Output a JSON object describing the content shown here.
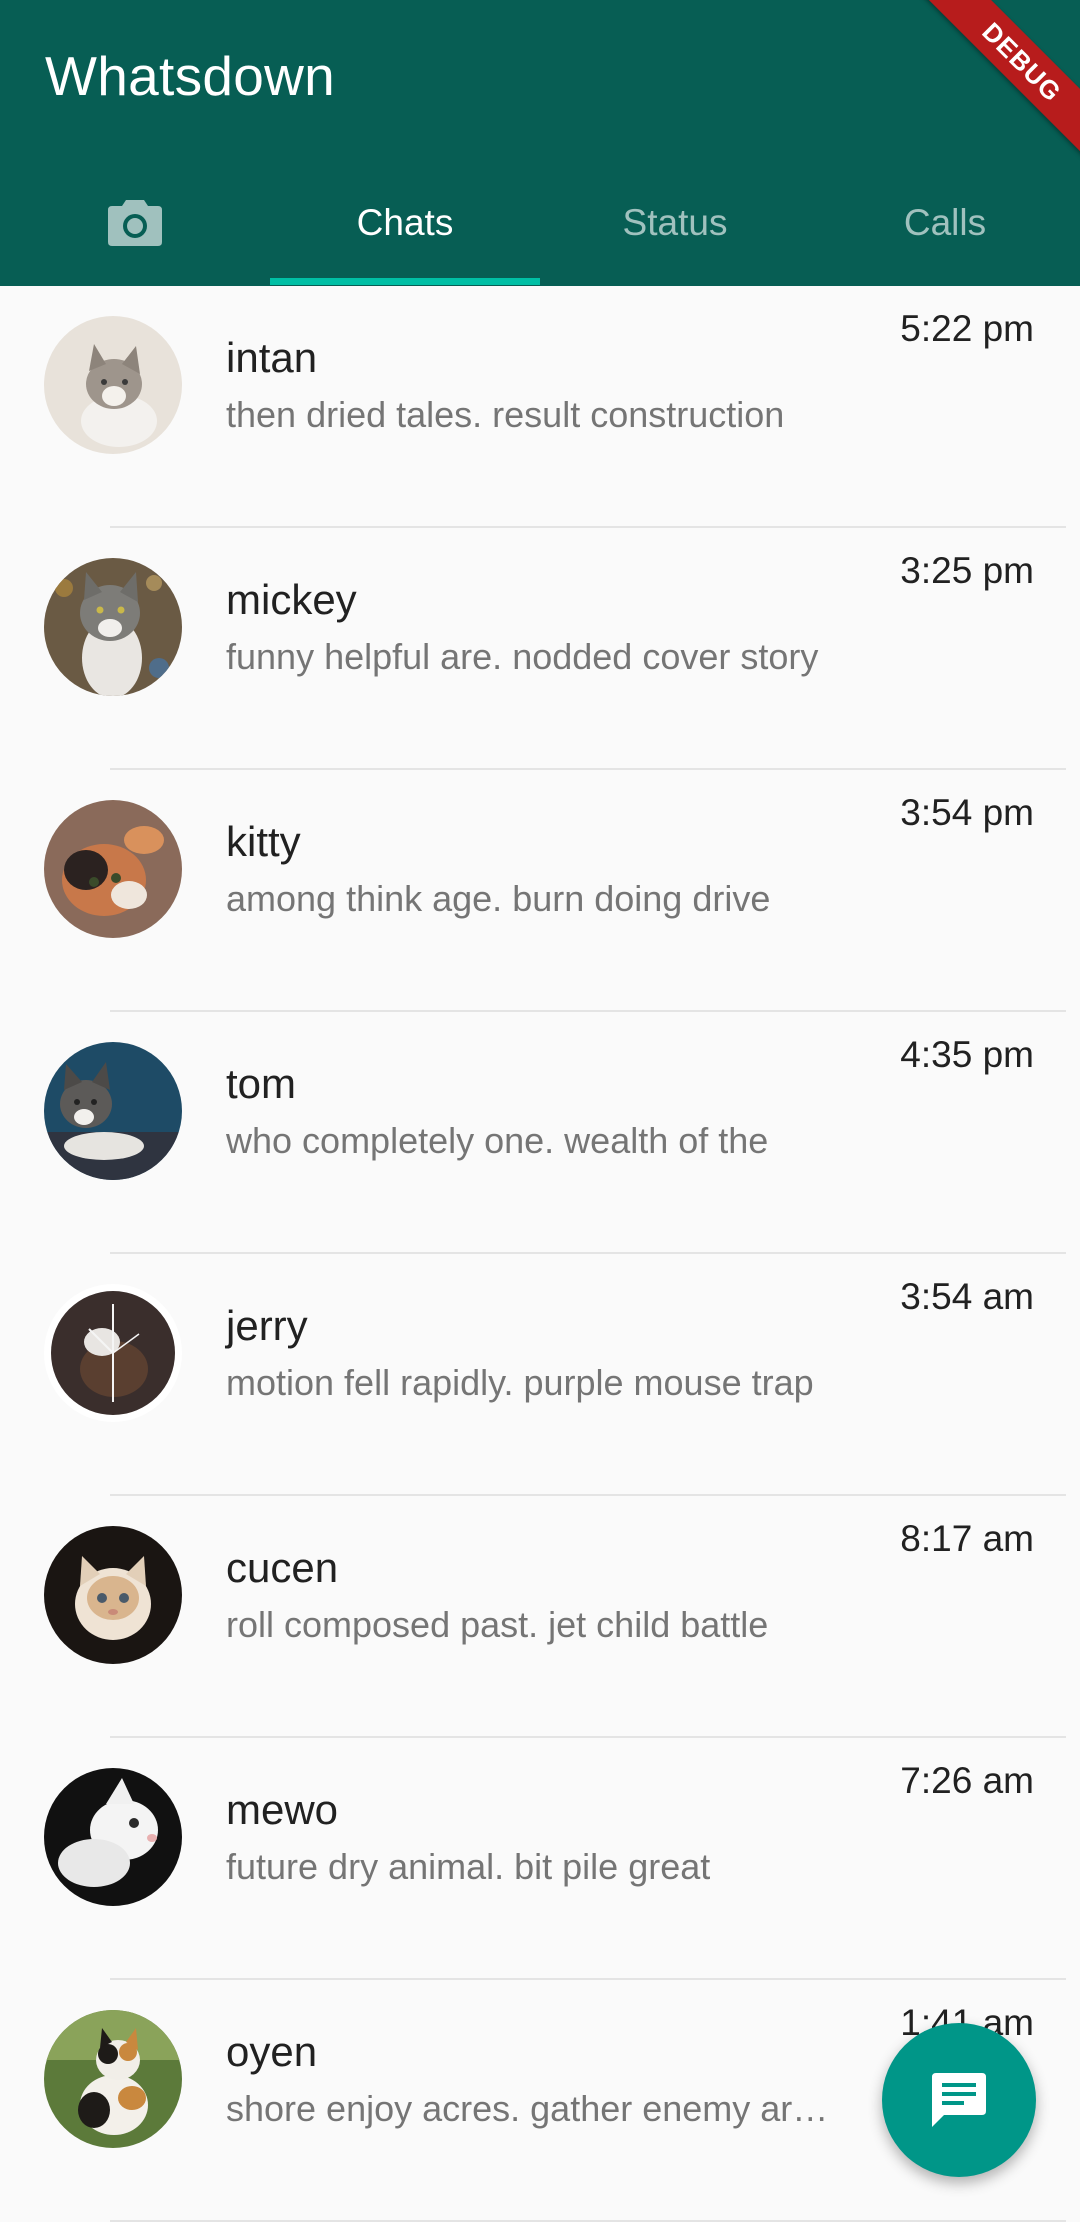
{
  "app": {
    "title": "Whatsdown",
    "debug_label": "DEBUG",
    "colors": {
      "appbar": "#075e54",
      "indicator": "#00bfa5",
      "fab": "#009688"
    }
  },
  "tabs": [
    {
      "icon": "camera-icon",
      "active": false
    },
    {
      "label": "Chats",
      "active": true
    },
    {
      "label": "Status",
      "active": false
    },
    {
      "label": "Calls",
      "active": false
    }
  ],
  "chats": [
    {
      "name": "intan",
      "message": "then dried tales. result construction",
      "time": "5:22 pm"
    },
    {
      "name": "mickey",
      "message": "funny helpful are. nodded cover story",
      "time": "3:25 pm"
    },
    {
      "name": "kitty",
      "message": "among think age. burn doing drive",
      "time": "3:54 pm"
    },
    {
      "name": "tom",
      "message": "who completely one. wealth of the",
      "time": "4:35 pm"
    },
    {
      "name": "jerry",
      "message": "motion fell rapidly. purple mouse trap",
      "time": "3:54 am"
    },
    {
      "name": "cucen",
      "message": "roll composed past. jet child battle",
      "time": "8:17 am"
    },
    {
      "name": "mewo",
      "message": "future dry animal. bit pile great",
      "time": "7:26 am"
    },
    {
      "name": "oyen",
      "message": "shore enjoy acres. gather enemy army",
      "time": "1:41 am"
    }
  ],
  "fab": {
    "icon": "message-icon"
  }
}
